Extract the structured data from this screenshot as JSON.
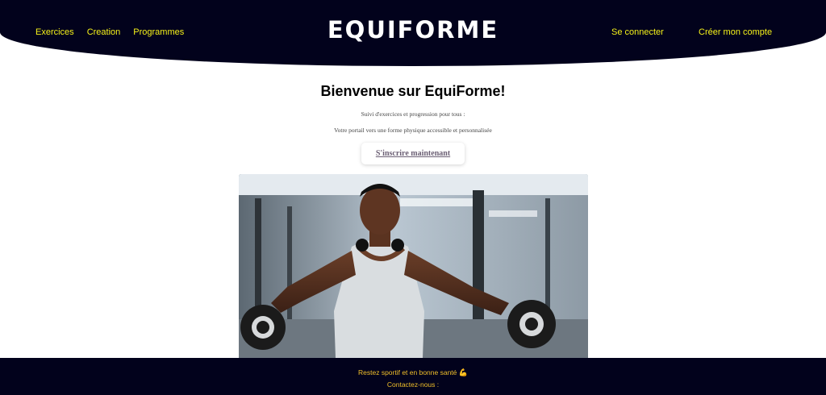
{
  "header": {
    "brand": "EQUIFORME",
    "nav_left": [
      {
        "label": "Exercices"
      },
      {
        "label": "Creation"
      },
      {
        "label": "Programmes"
      }
    ],
    "login_label": "Se connecter",
    "register_label": "Créer mon compte"
  },
  "main": {
    "title": "Bienvenue sur EquiForme!",
    "subtitle_1": "Suivi d'exercices et progression pour tous :",
    "subtitle_2": "Votre portail vers une forme physique accessible et personnalisée",
    "cta_label": "S'inscrire maintenant",
    "hero_image": "gym-athlete-dumbbell-lateral-raise-photo"
  },
  "footer": {
    "line_1": "Restez sportif et en bonne santé",
    "line_1_emoji": "💪",
    "line_2": "Contactez-nous :"
  },
  "colors": {
    "header_bg": "#02021c",
    "nav_text": "#f6f219",
    "footer_text": "#f1bf2a",
    "cta_text": "#6b5f74"
  }
}
